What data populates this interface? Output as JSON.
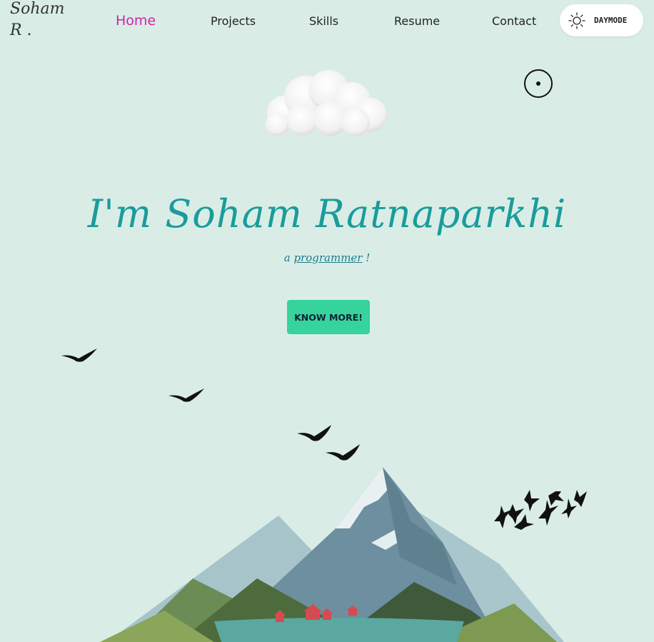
{
  "logo": {
    "line1": "Soham",
    "line2": "R ."
  },
  "nav": {
    "items": [
      {
        "label": "Home",
        "active": true
      },
      {
        "label": "Projects"
      },
      {
        "label": "Skills"
      },
      {
        "label": "Resume"
      },
      {
        "label": "Contact"
      }
    ],
    "mode_toggle": {
      "label": "DAYMODE",
      "icon": "sun-icon"
    }
  },
  "hero": {
    "title": "I'm Soham Ratnaparkhi",
    "subtitle_prefix": "a",
    "subtitle_word": "programmer",
    "subtitle_suffix": "!",
    "cta_label": "KNOW MORE!"
  },
  "colors": {
    "background": "#d9ede6",
    "active_nav": "#d61fa9",
    "title": "#1a9c9b",
    "cta": "#36d39c"
  }
}
